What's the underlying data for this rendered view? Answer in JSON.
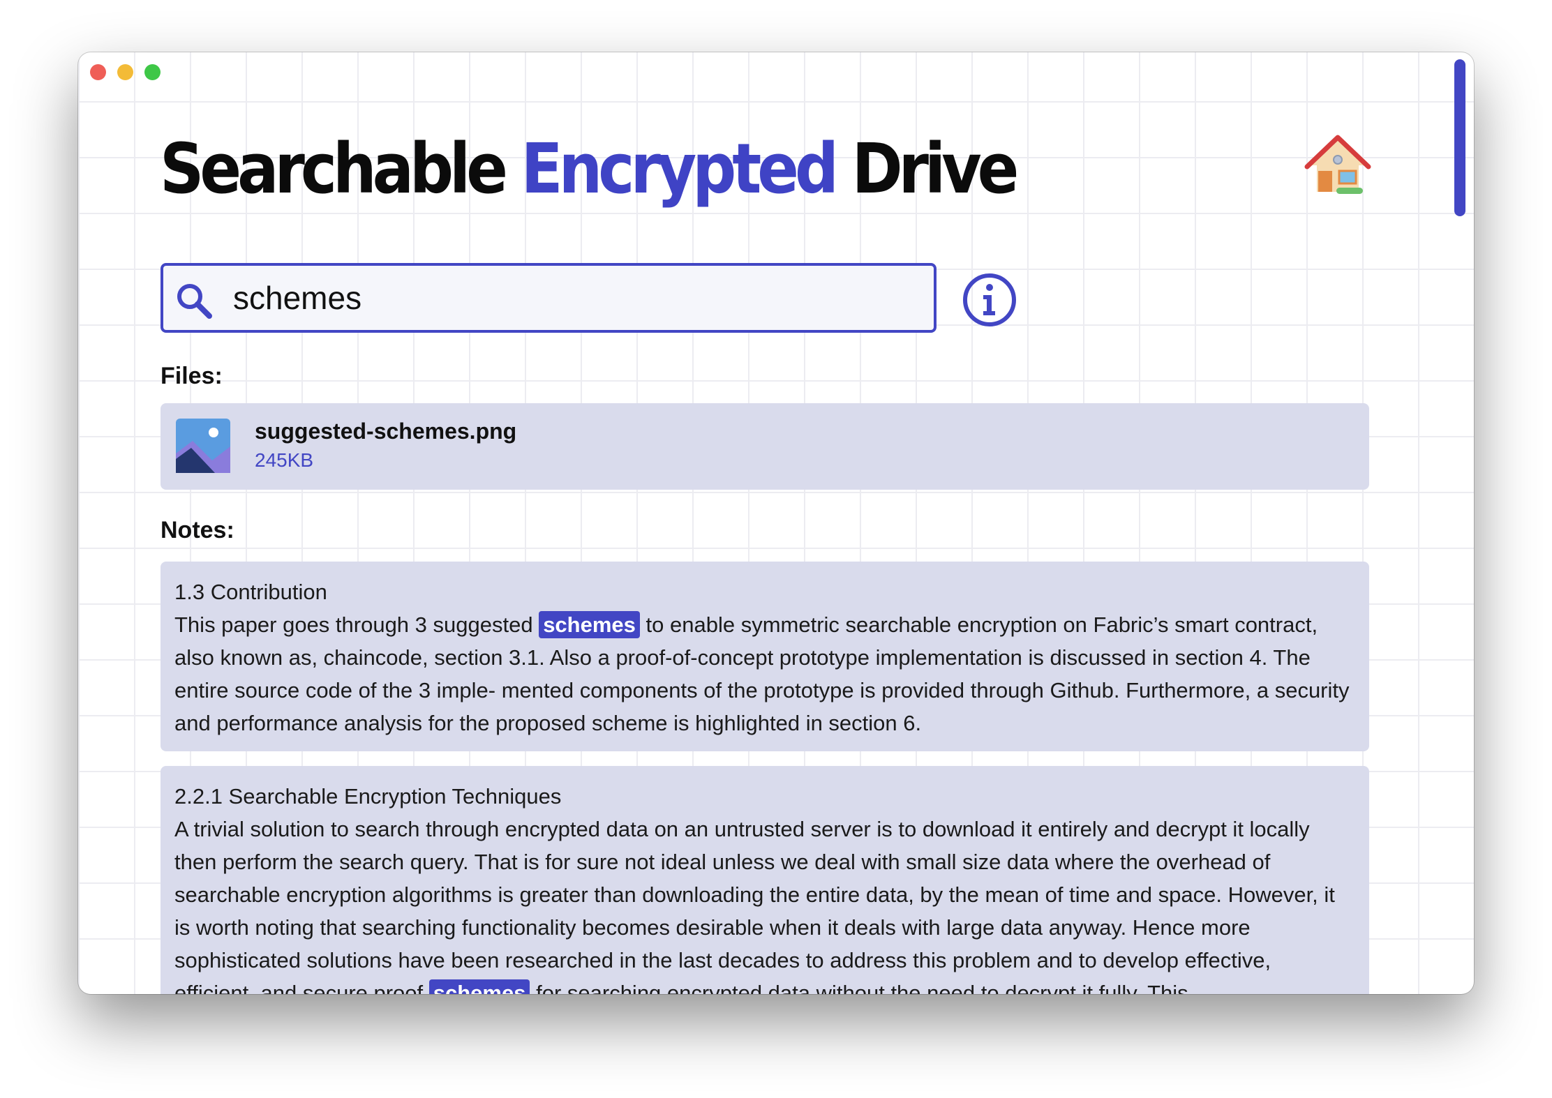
{
  "app": {
    "title_part1": "Searchable",
    "title_part2": "Encrypted",
    "title_part3": "Drive",
    "accent_color": "#4246c4"
  },
  "search": {
    "value": "schemes",
    "icon": "search-icon"
  },
  "info_icon": "info-icon",
  "home_icon": "house-icon",
  "files": {
    "label": "Files:",
    "items": [
      {
        "name": "suggested-schemes.png",
        "size": "245KB",
        "icon": "image-file-icon"
      }
    ]
  },
  "notes": {
    "label": "Notes:",
    "items": [
      {
        "title": "1.3 Contribution",
        "body_before": "This paper goes through 3 suggested ",
        "highlight": "schemes",
        "body_after": " to enable symmetric searchable encryption on Fabric’s smart contract, also known as, chaincode, section 3.1. Also a proof-of-concept prototype implementation is discussed in section 4. The entire source code of the 3 imple- mented components of the prototype is provided through Github. Furthermore, a security and performance analysis for the proposed scheme is highlighted in section 6."
      },
      {
        "title": "2.2.1 Searchable Encryption Techniques",
        "body_before": "A trivial solution to search through encrypted data on an untrusted server is to download it entirely and decrypt it locally then perform the search query. That is for sure not ideal unless we deal with small size data where the overhead of searchable encryption algorithms is greater than downloading the entire data, by the mean of time and space. However, it is worth noting that searching functionality becomes desirable when it deals with large data anyway. Hence more sophisticated solutions have been researched in the last decades to address this problem and to develop effective, efficient, and secure proof ",
        "highlight": "schemes",
        "body_after": " for searching encrypted data without the need to decrypt it fully. This"
      }
    ]
  }
}
